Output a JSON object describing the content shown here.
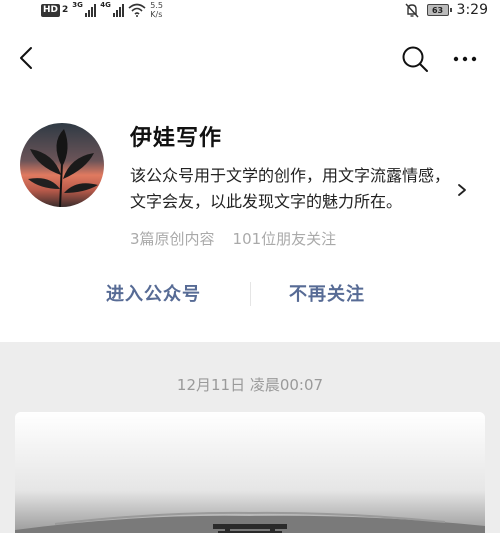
{
  "status_bar": {
    "hd_label": "HD",
    "sim_slot": "2",
    "network_1": "3G",
    "network_2": "4G",
    "speed_value": "5.5",
    "speed_unit": "K/s",
    "battery_level": "63",
    "time": "3:29",
    "icons": [
      "signal-icon",
      "wifi-icon",
      "bell-off-icon",
      "battery-icon"
    ]
  },
  "nav": {
    "icons": [
      "back-icon",
      "search-icon",
      "more-icon"
    ]
  },
  "profile": {
    "name": "伊娃写作",
    "description": "该公众号用于文学的创作，用文字流露情感，文字会友，以此发现文字的魅力所在。",
    "stats": {
      "articles": "3篇原创内容",
      "followers": "101位朋友关注"
    }
  },
  "actions": {
    "enter": "进入公众号",
    "unfollow": "不再关注"
  },
  "feed": {
    "date": "12月11日 凌晨00:07"
  },
  "colors": {
    "link": "#576b95",
    "background": "#ededed",
    "muted": "#aaaaaa"
  }
}
